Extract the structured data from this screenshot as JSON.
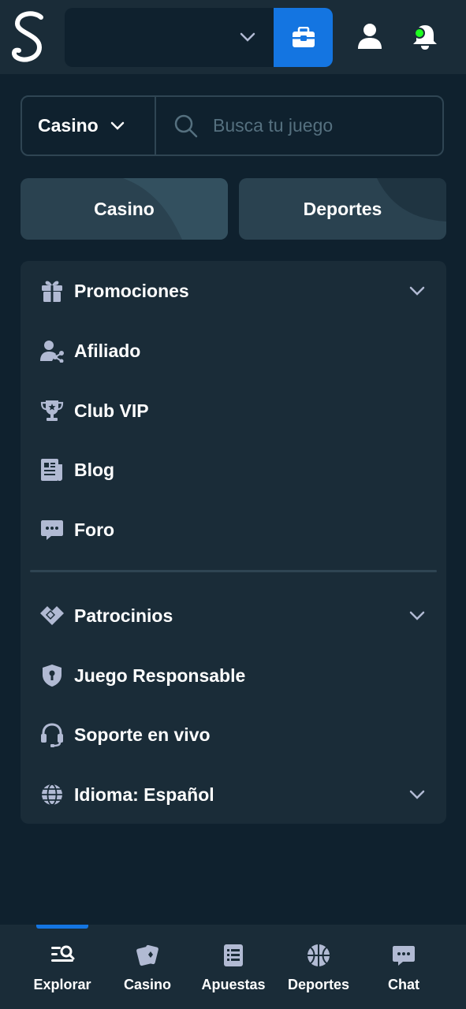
{
  "header": {
    "logo": "S",
    "colors": {
      "bg": "#1a2c38",
      "wallet": "#1475e1",
      "notif_dot": "#1fff20"
    },
    "icons": [
      "chevron-down-icon",
      "wallet-icon",
      "user-icon",
      "bell-icon"
    ]
  },
  "search": {
    "category": "Casino",
    "placeholder": "Busca tu juego"
  },
  "segments": [
    {
      "label": "Casino"
    },
    {
      "label": "Deportes"
    }
  ],
  "menu": {
    "items": [
      {
        "label": "Promociones",
        "icon": "gift-icon",
        "expandable": true
      },
      {
        "label": "Afiliado",
        "icon": "affiliate-icon",
        "expandable": false
      },
      {
        "label": "Club VIP",
        "icon": "trophy-icon",
        "expandable": false
      },
      {
        "label": "Blog",
        "icon": "newspaper-icon",
        "expandable": false
      },
      {
        "label": "Foro",
        "icon": "chat-bubble-icon",
        "expandable": false
      },
      {
        "label": "Patrocinios",
        "icon": "handshake-icon",
        "expandable": true
      },
      {
        "label": "Juego Responsable",
        "icon": "shield-icon",
        "expandable": false
      },
      {
        "label": "Soporte en vivo",
        "icon": "headset-icon",
        "expandable": false
      },
      {
        "label": "Idioma: Español",
        "icon": "globe-icon",
        "expandable": true
      }
    ]
  },
  "bottom_nav": {
    "active": "Explorar",
    "items": [
      {
        "label": "Explorar",
        "icon": "explore-icon"
      },
      {
        "label": "Casino",
        "icon": "cards-icon"
      },
      {
        "label": "Apuestas",
        "icon": "betslip-icon"
      },
      {
        "label": "Deportes",
        "icon": "basketball-icon"
      },
      {
        "label": "Chat",
        "icon": "chat-icon"
      }
    ]
  }
}
